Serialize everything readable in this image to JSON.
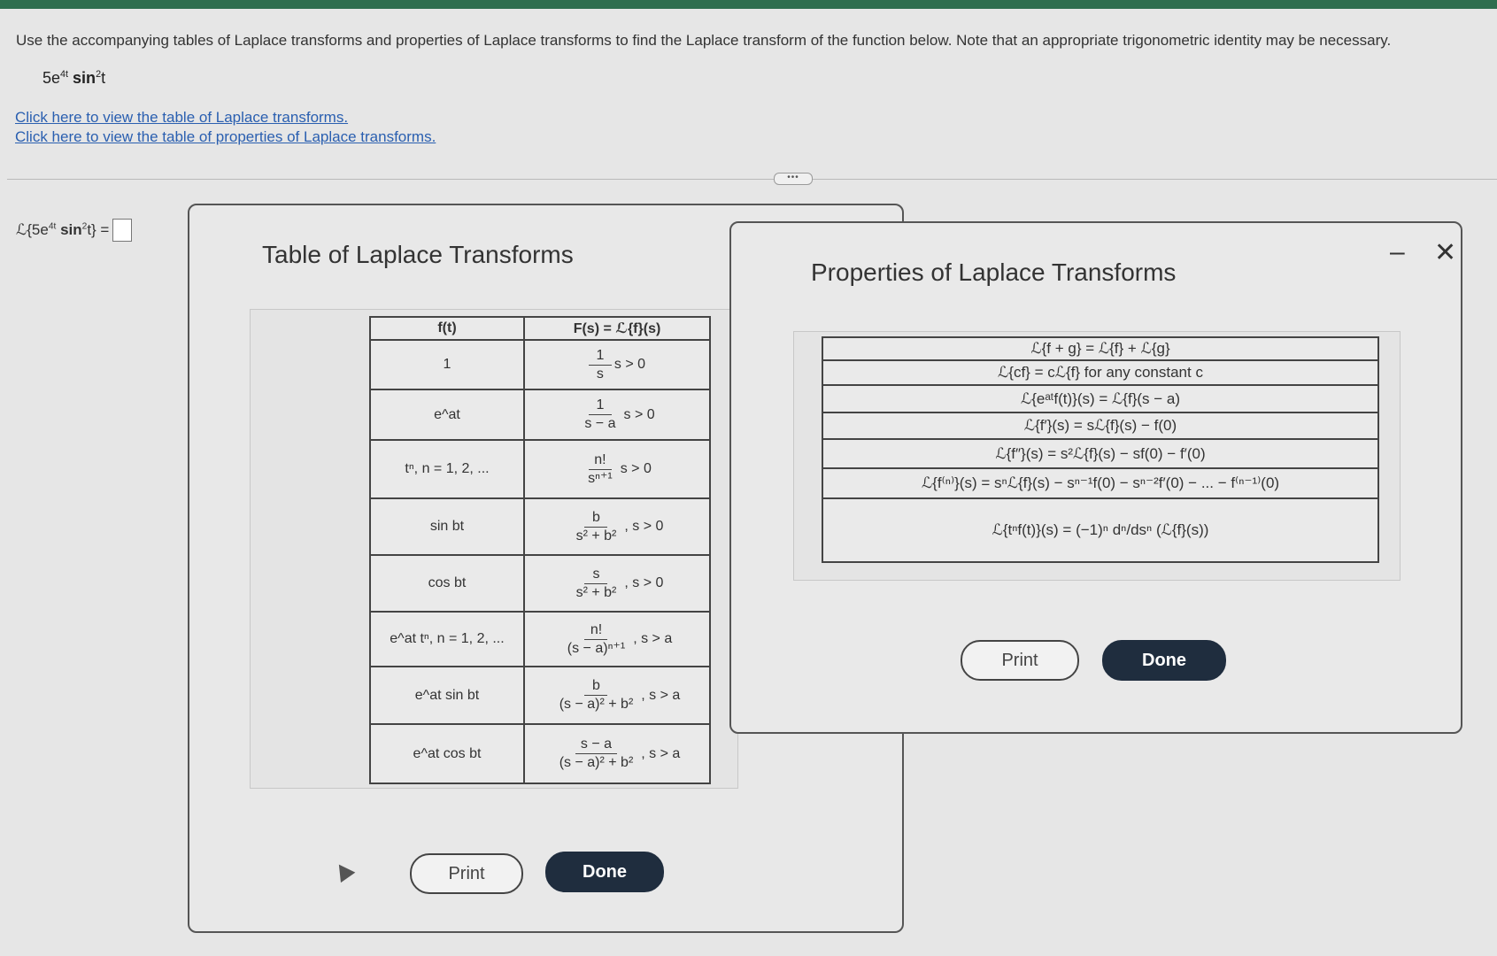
{
  "question": {
    "text": "Use the accompanying tables of Laplace transforms and properties of Laplace transforms to find the Laplace transform of the function below. Note that an appropriate trigonometric identity may be necessary.",
    "function_coef": "5e",
    "function_exp": "4t",
    "function_trig": " sin",
    "function_trig_exp": "2",
    "function_var": "t"
  },
  "links": {
    "table": "Click here to view the table of Laplace transforms.",
    "properties": "Click here to view the table of properties of Laplace transforms."
  },
  "answer": {
    "prefix": "ℒ{5e",
    "exp": "4t",
    "trig": " sin",
    "trig_exp": "2",
    "suffix": "t} ="
  },
  "more_button": "•••",
  "laplace_table": {
    "title": "Table of Laplace Transforms",
    "header_ft": "f(t)",
    "header_fs": "F(s) = ℒ{f}(s)",
    "rows": [
      {
        "ft": "1",
        "num": "1",
        "den": "s",
        "cond": "s > 0"
      },
      {
        "ft": "e^at",
        "num": "1",
        "den": "s − a",
        "cond": "s > 0"
      },
      {
        "ft": "tⁿ, n = 1, 2, ...",
        "num": "n!",
        "den": "sⁿ⁺¹",
        "cond": "s > 0"
      },
      {
        "ft": "sin bt",
        "num": "b",
        "den": "s² + b²",
        "cond": ", s > 0"
      },
      {
        "ft": "cos bt",
        "num": "s",
        "den": "s² + b²",
        "cond": ", s > 0"
      },
      {
        "ft": "e^at tⁿ, n = 1, 2, ...",
        "num": "n!",
        "den": "(s − a)ⁿ⁺¹",
        "cond": ", s > a"
      },
      {
        "ft": "e^at sin bt",
        "num": "b",
        "den": "(s − a)² + b²",
        "cond": ", s > a"
      },
      {
        "ft": "e^at cos bt",
        "num": "s − a",
        "den": "(s − a)² + b²",
        "cond": ", s > a"
      }
    ],
    "print_label": "Print",
    "done_label": "Done"
  },
  "properties_table": {
    "title": "Properties of Laplace Transforms",
    "rows": [
      "ℒ{f + g} = ℒ{f} + ℒ{g}",
      "ℒ{cf} = cℒ{f} for any constant c",
      "ℒ{eᵃᵗf(t)}(s) = ℒ{f}(s − a)",
      "ℒ{f′}(s) = sℒ{f}(s) − f(0)",
      "ℒ{f″}(s) = s²ℒ{f}(s) − sf(0) − f′(0)",
      "ℒ{f⁽ⁿ⁾}(s) = sⁿℒ{f}(s) − sⁿ⁻¹f(0) − sⁿ⁻²f′(0) − ... − f⁽ⁿ⁻¹⁾(0)",
      "ℒ{tⁿf(t)}(s) = (−1)ⁿ dⁿ/dsⁿ (ℒ{f}(s))"
    ],
    "print_label": "Print",
    "done_label": "Done",
    "minimize": "–",
    "close": "✕"
  }
}
